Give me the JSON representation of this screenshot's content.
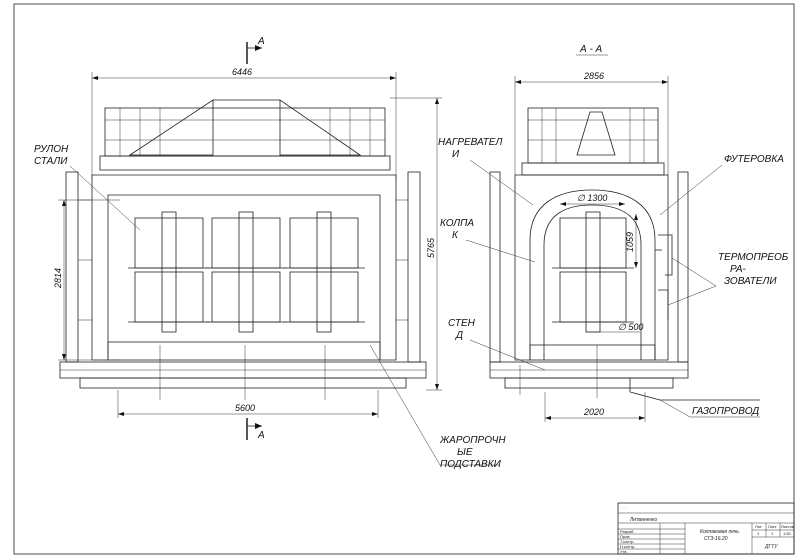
{
  "section_marks": {
    "top": "А",
    "bottom": "А",
    "section_title": "А - А"
  },
  "dimensions": {
    "overall_width_left": "6446",
    "height_right": "5765",
    "coil_height": "2814",
    "inner_width_left": "5600",
    "overall_width_right": "2856",
    "dome_diameter": "∅ 1300",
    "dome_height": "1059",
    "post_diameter": "∅ 500",
    "base_width_right": "2020"
  },
  "labels": {
    "coil": [
      "РУЛОН",
      "СТАЛИ"
    ],
    "heaters": [
      "НАГРЕВАТЕЛ",
      "И"
    ],
    "bell": [
      "КОЛПА",
      "К"
    ],
    "stand": [
      "СТЕН",
      "Д"
    ],
    "lining": "ФУТЕРОВКА",
    "thermocouples": [
      "ТЕРМОПРЕОБ",
      "РА-",
      "ЗОВАТЕЛИ"
    ],
    "gas_pipe": "ГАЗОПРОВОД",
    "supports": [
      "ЖАРОПРОЧН",
      "ЫЕ",
      "ПОДСТАВКИ"
    ]
  },
  "title_block": {
    "header": "…",
    "drawing_name": [
      "Колпаковая печь",
      "СГЗ-16.20"
    ],
    "sheet_labels": [
      "Лит.",
      "Лист",
      "Листов"
    ],
    "sheet_values": [
      "1",
      "1",
      "1:50"
    ],
    "organization": "ДГТУ",
    "signature": "Литвиненко",
    "roles": [
      "Разраб.",
      "Пров.",
      "Т.контр.",
      "Н.контр.",
      "Утв."
    ]
  },
  "colors": {
    "line": "#222222",
    "background": "#ffffff"
  }
}
